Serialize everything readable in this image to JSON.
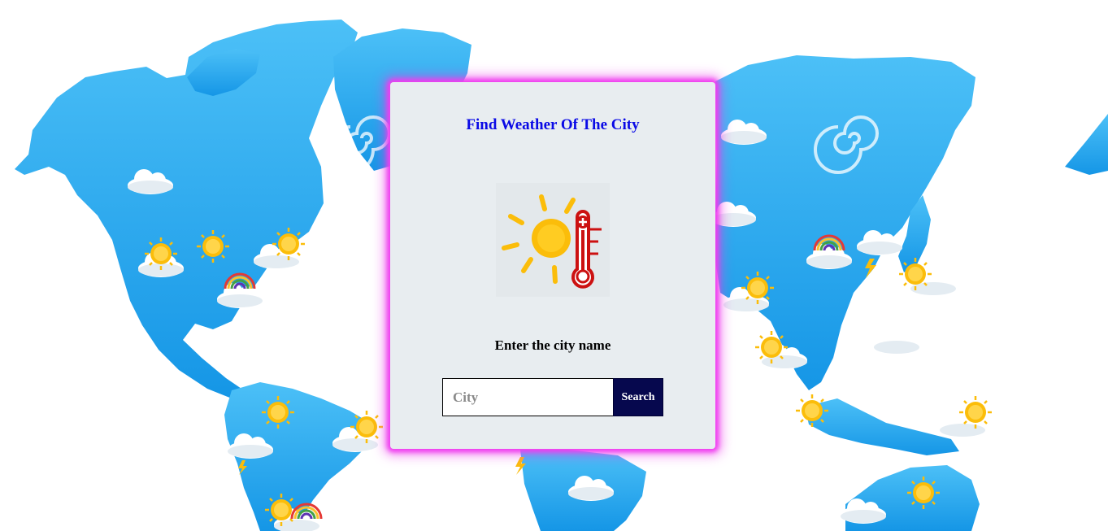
{
  "card": {
    "title": "Find Weather Of The City",
    "prompt": "Enter the city name"
  },
  "search": {
    "placeholder": "City",
    "value": "",
    "button_label": "Search"
  },
  "colors": {
    "title": "#0a0ae6",
    "button_bg": "#06084e",
    "card_bg": "#e8edf0",
    "card_glow": "#f03cf0",
    "map_land": "#2aa6f0",
    "sun": "#fbbd0a",
    "thermometer": "#cc1111"
  },
  "icons": {
    "hero": [
      "sun-icon",
      "thermometer-icon"
    ],
    "map_decor": [
      "cloud-icon",
      "sun-icon",
      "rainbow-icon",
      "swirl-icon",
      "lightning-icon"
    ]
  }
}
